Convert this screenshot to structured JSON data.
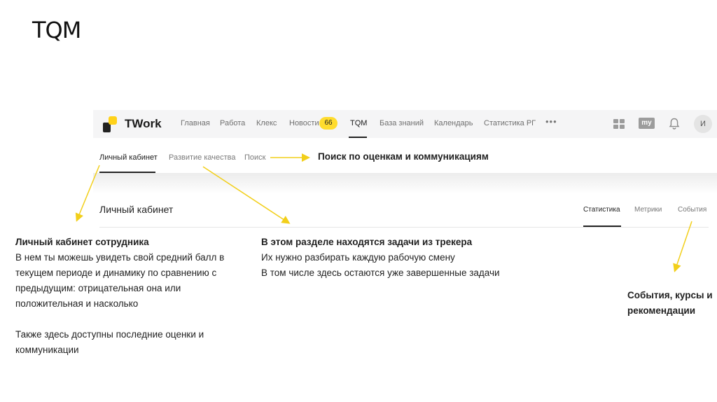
{
  "slide": {
    "title": "TQM"
  },
  "app": {
    "brand": "TWork",
    "nav": [
      {
        "label": "Главная"
      },
      {
        "label": "Работа"
      },
      {
        "label": "Клекс"
      },
      {
        "label": "Новости"
      },
      {
        "label": "TQM"
      },
      {
        "label": "База знаний"
      },
      {
        "label": "Календарь"
      },
      {
        "label": "Статистика РГ"
      }
    ],
    "news_badge": "66",
    "more": "•••",
    "my_badge": "my",
    "avatar": "И",
    "subnav": [
      {
        "label": "Личный кабинет"
      },
      {
        "label": "Развитие качества"
      },
      {
        "label": "Поиск"
      }
    ],
    "section_title": "Личный кабинет",
    "tabs": [
      {
        "label": "Статистика"
      },
      {
        "label": "Метрики"
      },
      {
        "label": "События"
      }
    ],
    "colors": {
      "accent": "#ffdc2e",
      "arrow": "#f2cf1a"
    }
  },
  "callouts": {
    "search": "Поиск по оценкам и коммуникациям",
    "cabinet": {
      "heading": "Личный кабинет сотрудника",
      "lines": [
        "В нем ты можешь увидеть свой средний балл в",
        "текущем периоде и динамику по сравнению с",
        "предыдущим: отрицательная она или",
        "положительная и насколько"
      ],
      "extra": [
        "Также здесь доступны последние оценки и",
        "коммуникации"
      ]
    },
    "tracker": {
      "heading": "В этом разделе находятся задачи из трекера",
      "lines": [
        "Их нужно разбирать каждую рабочую смену",
        "В том числе здесь остаются уже завершенные задачи"
      ]
    },
    "events": {
      "lines": [
        "События, курсы и",
        "рекомендации"
      ]
    }
  }
}
